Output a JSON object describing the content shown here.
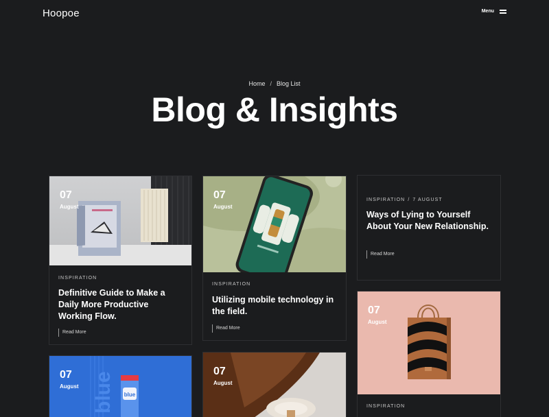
{
  "header": {
    "logo": "Hoopoe",
    "menu_label": "Menu"
  },
  "breadcrumb": {
    "home": "Home",
    "separator": "/",
    "current": "Blog List"
  },
  "page_title": "Blog & Insights",
  "posts": [
    {
      "day": "07",
      "month": "August",
      "category": "INSPIRATION",
      "title": "Definitive Guide to Make a Daily More Productive Working Flow.",
      "read_more": "Read More"
    },
    {
      "day": "07",
      "month": "August",
      "category": "INSPIRATION",
      "title": "Utilizing mobile technology in the field.",
      "read_more": "Read More"
    },
    {
      "category": "INSPIRATION",
      "date": "7 AUGUST",
      "title": "Ways of Lying to Yourself About Your New Relationship.",
      "read_more": "Read More"
    },
    {
      "day": "07",
      "month": "August",
      "category": "INSPIRATION"
    },
    {
      "day": "07",
      "month": "August"
    },
    {
      "day": "07",
      "month": "August"
    }
  ],
  "colors": {
    "background": "#1b1c1e",
    "card_border": "#2e2f32",
    "text": "#ffffff"
  }
}
